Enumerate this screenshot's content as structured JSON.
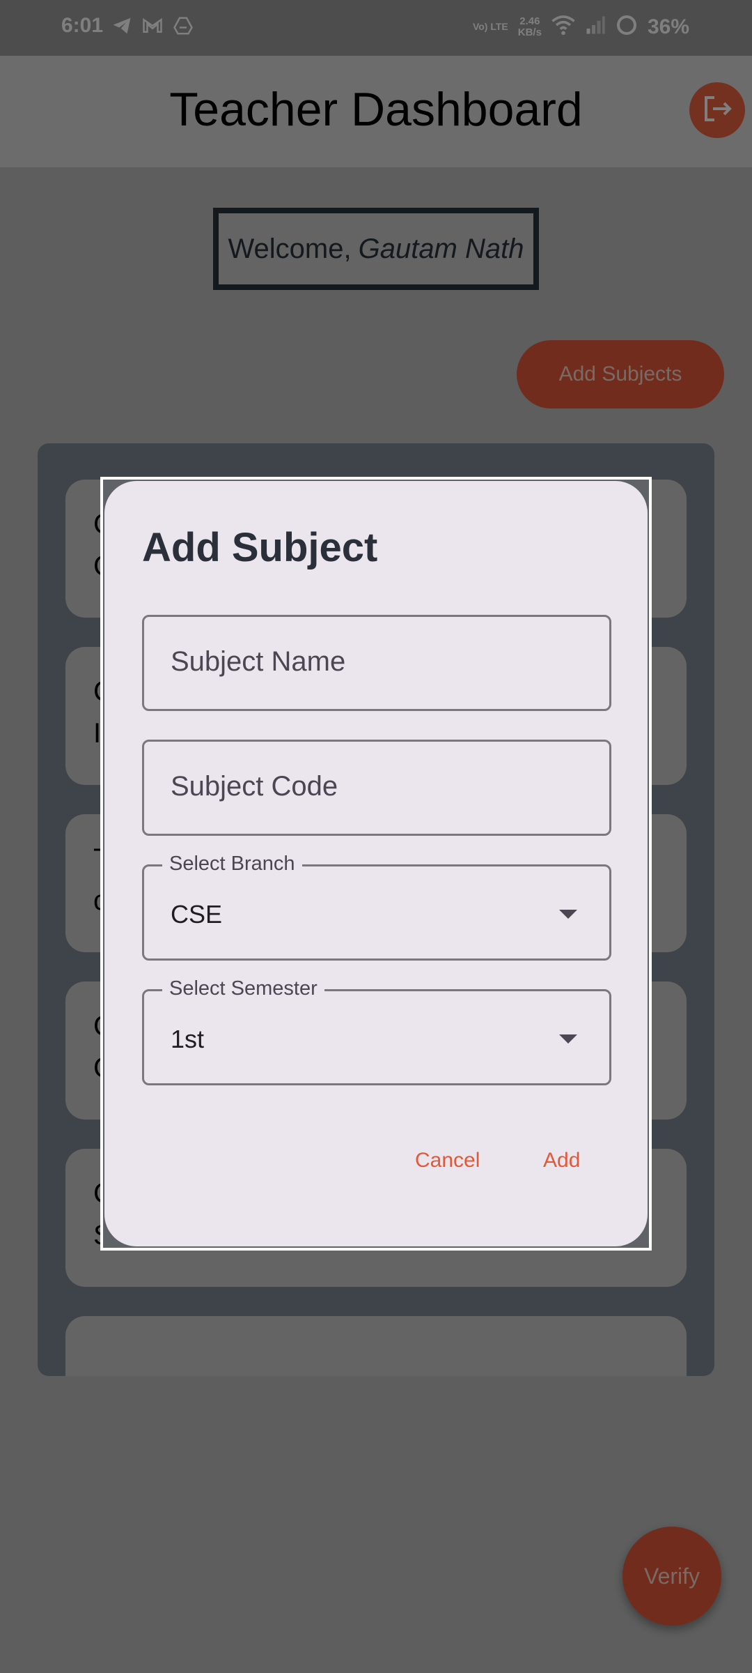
{
  "status_bar": {
    "time": "6:01",
    "left_icons": [
      "telegram-icon",
      "gmail-icon",
      "drive-icon"
    ],
    "network_type": "Vo) LTE",
    "speed_value": "2.46",
    "speed_unit": "KB/s",
    "right_icons": [
      "wifi-icon",
      "signal-icon",
      "battery-icon"
    ],
    "battery_percent": "36%"
  },
  "app_bar": {
    "title": "Teacher Dashboard",
    "logout_icon": "logout-icon"
  },
  "welcome": {
    "prefix": "Welcome,",
    "name": "Gautam Nath"
  },
  "add_subjects_label": "Add Subjects",
  "subject_list": {
    "visible_fragments": [
      [
        "C",
        "C"
      ],
      [
        "C",
        "I"
      ],
      [
        "T",
        "c"
      ],
      [
        "C",
        "C"
      ],
      [
        "C",
        "Sc"
      ]
    ]
  },
  "verify_label": "Verify",
  "dialog": {
    "title": "Add Subject",
    "subject_name_placeholder": "Subject Name",
    "subject_code_placeholder": "Subject Code",
    "branch": {
      "label": "Select Branch",
      "value": "CSE"
    },
    "semester": {
      "label": "Select Semester",
      "value": "1st"
    },
    "cancel_label": "Cancel",
    "add_label": "Add"
  },
  "colors": {
    "accent": "#e5583a",
    "dialog_bg": "#ebe5ee",
    "title_text": "#2a2f3a"
  }
}
